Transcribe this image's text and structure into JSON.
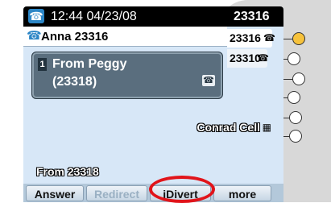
{
  "status": {
    "phone_icon": "phone-icon",
    "datetime": "12:44 04/23/08",
    "extension": "23316"
  },
  "line_header": {
    "icon": "phone-icon",
    "label": "Anna 23316"
  },
  "call": {
    "index": "1",
    "name": "From Peggy",
    "number": "(23318)",
    "icon": "phone-icon"
  },
  "lines": [
    {
      "label": "23316",
      "icon": "phone-icon",
      "active": true
    },
    {
      "label": "23310",
      "icon": "phone-icon",
      "active": false
    }
  ],
  "speed_dial": {
    "label": "Conrad Cell",
    "icon": "grid-icon"
  },
  "prompt": "From 23318",
  "softkeys": {
    "answer": "Answer",
    "redirect": "Redirect",
    "idivert": "iDivert",
    "more": "more"
  },
  "colors": {
    "accent": "#2c86c6",
    "highlight": "#e1141a",
    "active_line_button": "#f6c23c"
  }
}
